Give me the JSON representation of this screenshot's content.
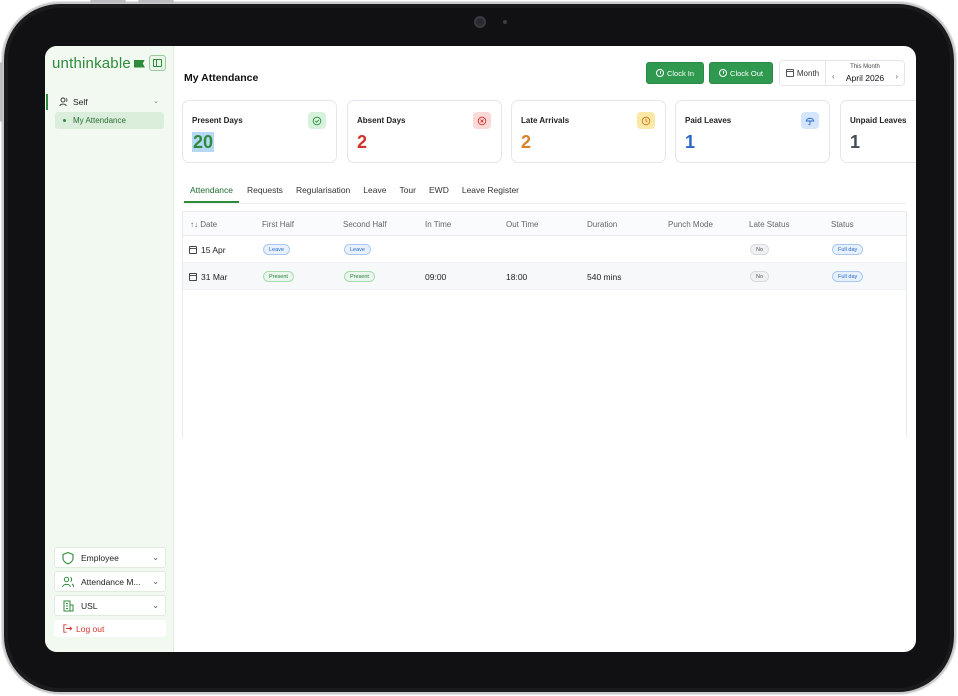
{
  "brand": {
    "name": "unthinkable",
    "accent": "#2e8b3b"
  },
  "sidebar": {
    "section": "Self",
    "active_item": "My Attendance",
    "bottom": [
      {
        "label": "Employee",
        "icon": "shield-icon"
      },
      {
        "label": "Attendance M...",
        "icon": "users-icon"
      },
      {
        "label": "USL",
        "icon": "building-icon"
      }
    ],
    "logout": "Log out"
  },
  "header": {
    "title": "My Attendance",
    "clock_in": "Clock In",
    "clock_out": "Clock Out",
    "period_mode": "Month",
    "period_caption": "This Month",
    "period_value": "April 2026"
  },
  "stats": [
    {
      "label": "Present Days",
      "value": "20",
      "color": "#2e8b3b",
      "icon": "check-circle-icon"
    },
    {
      "label": "Absent Days",
      "value": "2",
      "color": "#d0342c",
      "icon": "x-circle-icon"
    },
    {
      "label": "Late Arrivals",
      "value": "2",
      "color": "#d9822b",
      "icon": "clock-icon"
    },
    {
      "label": "Paid Leaves",
      "value": "1",
      "color": "#2a67c9",
      "icon": "umbrella-icon"
    },
    {
      "label": "Unpaid Leaves",
      "value": "1",
      "color": "#444c56",
      "icon": ""
    }
  ],
  "tabs": [
    "Attendance",
    "Requests",
    "Regularisation",
    "Leave",
    "Tour",
    "EWD",
    "Leave Register"
  ],
  "table": {
    "columns": [
      "Date",
      "First Half",
      "Second Half",
      "In Time",
      "Out Time",
      "Duration",
      "Punch Mode",
      "Late Status",
      "Status"
    ],
    "sort_glyph": "↑↓",
    "rows": [
      {
        "date": "15 Apr",
        "first_half": "Leave",
        "second_half": "Leave",
        "in_time": "",
        "out_time": "",
        "duration": "",
        "punch_mode": "",
        "late_status": "No",
        "status": "Full day"
      },
      {
        "date": "31 Mar",
        "first_half": "Present",
        "second_half": "Present",
        "in_time": "09:00",
        "out_time": "18:00",
        "duration": "540 mins",
        "punch_mode": "",
        "late_status": "No",
        "status": "Full day"
      }
    ]
  }
}
